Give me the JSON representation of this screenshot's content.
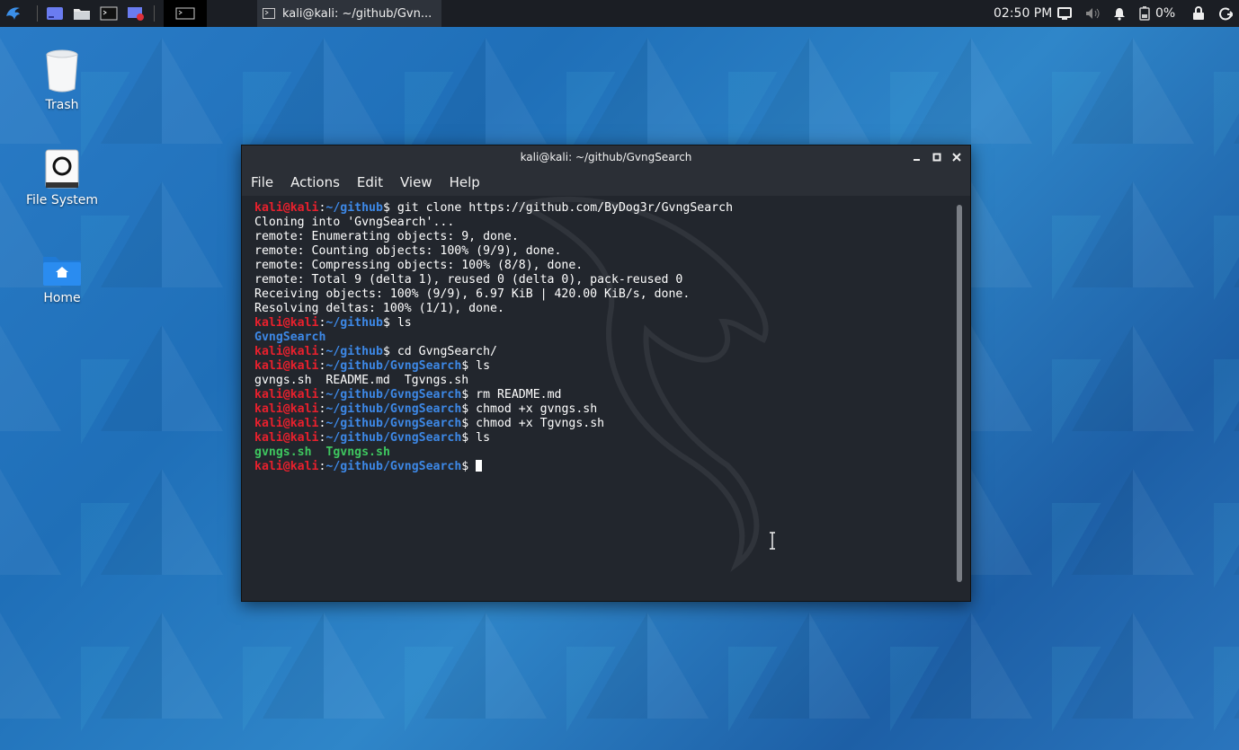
{
  "panel": {
    "task_title": "kali@kali: ~/github/Gvn...",
    "clock": "02:50 PM",
    "battery_pct": "0%"
  },
  "desktop": {
    "icons": [
      {
        "label": "Trash"
      },
      {
        "label": "File System"
      },
      {
        "label": "Home"
      }
    ]
  },
  "window": {
    "title": "kali@kali: ~/github/GvngSearch",
    "menu": [
      "File",
      "Actions",
      "Edit",
      "View",
      "Help"
    ]
  },
  "terminal": {
    "user": "kali@kali",
    "lines": [
      {
        "type": "prompt",
        "path": "~/github",
        "cmd": " git clone https://github.com/ByDog3r/GvngSearch"
      },
      {
        "type": "out",
        "text": "Cloning into 'GvngSearch'..."
      },
      {
        "type": "out",
        "text": "remote: Enumerating objects: 9, done."
      },
      {
        "type": "out",
        "text": "remote: Counting objects: 100% (9/9), done."
      },
      {
        "type": "out",
        "text": "remote: Compressing objects: 100% (8/8), done."
      },
      {
        "type": "out",
        "text": "remote: Total 9 (delta 1), reused 0 (delta 0), pack-reused 0"
      },
      {
        "type": "out",
        "text": "Receiving objects: 100% (9/9), 6.97 KiB | 420.00 KiB/s, done."
      },
      {
        "type": "out",
        "text": "Resolving deltas: 100% (1/1), done."
      },
      {
        "type": "prompt",
        "path": "~/github",
        "cmd": " ls"
      },
      {
        "type": "dir",
        "text": "GvngSearch"
      },
      {
        "type": "prompt",
        "path": "~/github",
        "cmd": " cd GvngSearch/"
      },
      {
        "type": "prompt",
        "path": "~/github/GvngSearch",
        "cmd": " ls"
      },
      {
        "type": "out",
        "text": "gvngs.sh  README.md  Tgvngs.sh"
      },
      {
        "type": "prompt",
        "path": "~/github/GvngSearch",
        "cmd": " rm README.md"
      },
      {
        "type": "prompt",
        "path": "~/github/GvngSearch",
        "cmd": " chmod +x gvngs.sh"
      },
      {
        "type": "prompt",
        "path": "~/github/GvngSearch",
        "cmd": " chmod +x Tgvngs.sh"
      },
      {
        "type": "prompt",
        "path": "~/github/GvngSearch",
        "cmd": " ls"
      },
      {
        "type": "exe",
        "items": [
          "gvngs.sh",
          "Tgvngs.sh"
        ]
      },
      {
        "type": "prompt",
        "path": "~/github/GvngSearch",
        "cmd": " ",
        "cursor": true
      }
    ]
  }
}
